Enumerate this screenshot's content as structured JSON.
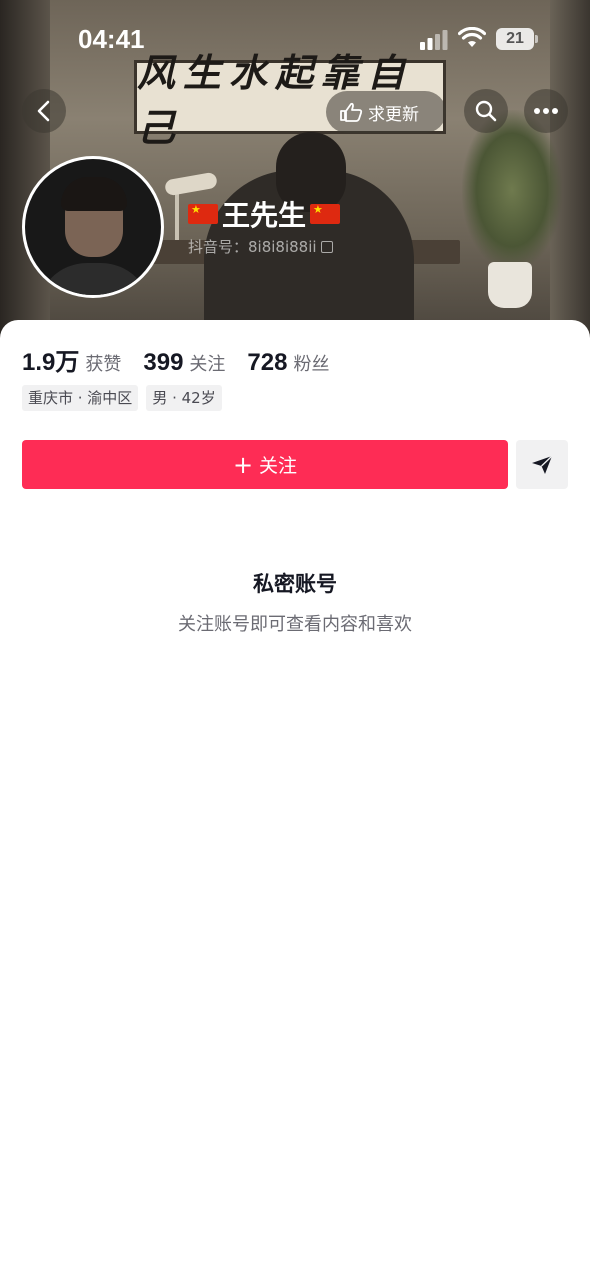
{
  "status_bar": {
    "time": "04:41",
    "battery": "21"
  },
  "header": {
    "scroll_text": "风生水起靠自己",
    "update_label": "求更新",
    "icons": {
      "back": "chevron-left-icon",
      "update": "hand-point-icon",
      "search": "search-icon",
      "more": "more-dots-icon"
    }
  },
  "profile": {
    "name": "王先生",
    "douyin_id": "抖音号：8i8i8i88ii",
    "flag": "china-flag"
  },
  "stats": [
    {
      "value": "1.9万",
      "label": "获赞"
    },
    {
      "value": "399",
      "label": "关注"
    },
    {
      "value": "728",
      "label": "粉丝"
    }
  ],
  "tags": [
    "重庆市 · 渝中区",
    "男 · 42岁"
  ],
  "actions": {
    "follow_label": "关注",
    "follow_color": "#fe2c55"
  },
  "private": {
    "title": "私密账号",
    "subtitle": "关注账号即可查看内容和喜欢"
  }
}
